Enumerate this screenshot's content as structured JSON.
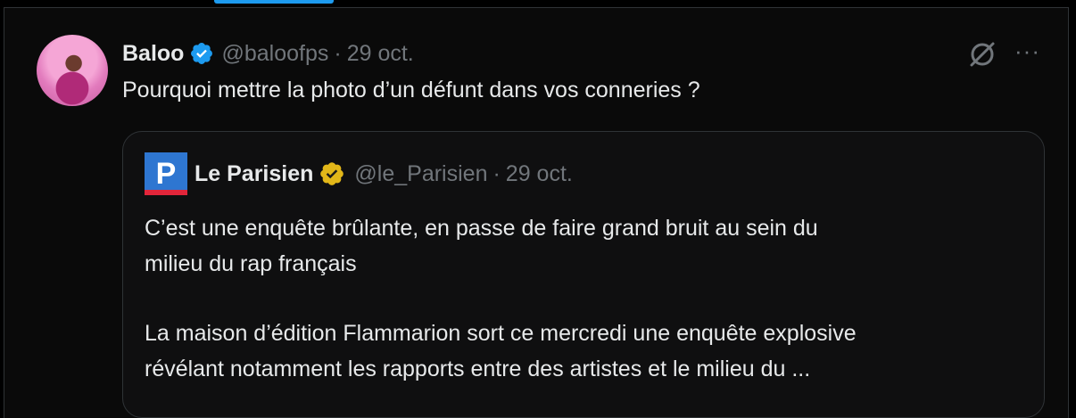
{
  "tweet": {
    "author_name": "Baloo",
    "handle": "@baloofps",
    "separator": "·",
    "date": "29 oct.",
    "text": "Pourquoi mettre la photo d’un défunt dans vos conneries ?",
    "more_label": "···"
  },
  "quoted": {
    "author_name": "Le Parisien",
    "logo_letter": "P",
    "handle": "@le_Parisien",
    "separator": "·",
    "date": "29 oct.",
    "lines": [
      "C’est une enquête brûlante, en passe de faire grand bruit au sein du",
      "milieu du rap français",
      "La maison d’édition Flammarion sort ce mercredi une enquête explosive",
      "révélant notamment les rapports entre des artistes et le milieu du ..."
    ]
  },
  "colors": {
    "background": "#000000",
    "text": "#e7e9ea",
    "muted": "#71767b",
    "verified_blue": "#1d9bf0",
    "verified_gold": "#e2b719",
    "parisien_blue": "#2e76d1",
    "parisien_red": "#e2253a"
  },
  "icons": {
    "verified": "verified-badge-icon",
    "gold_verified": "gold-verified-badge-icon",
    "grok": "grok-icon",
    "more": "more-icon"
  }
}
